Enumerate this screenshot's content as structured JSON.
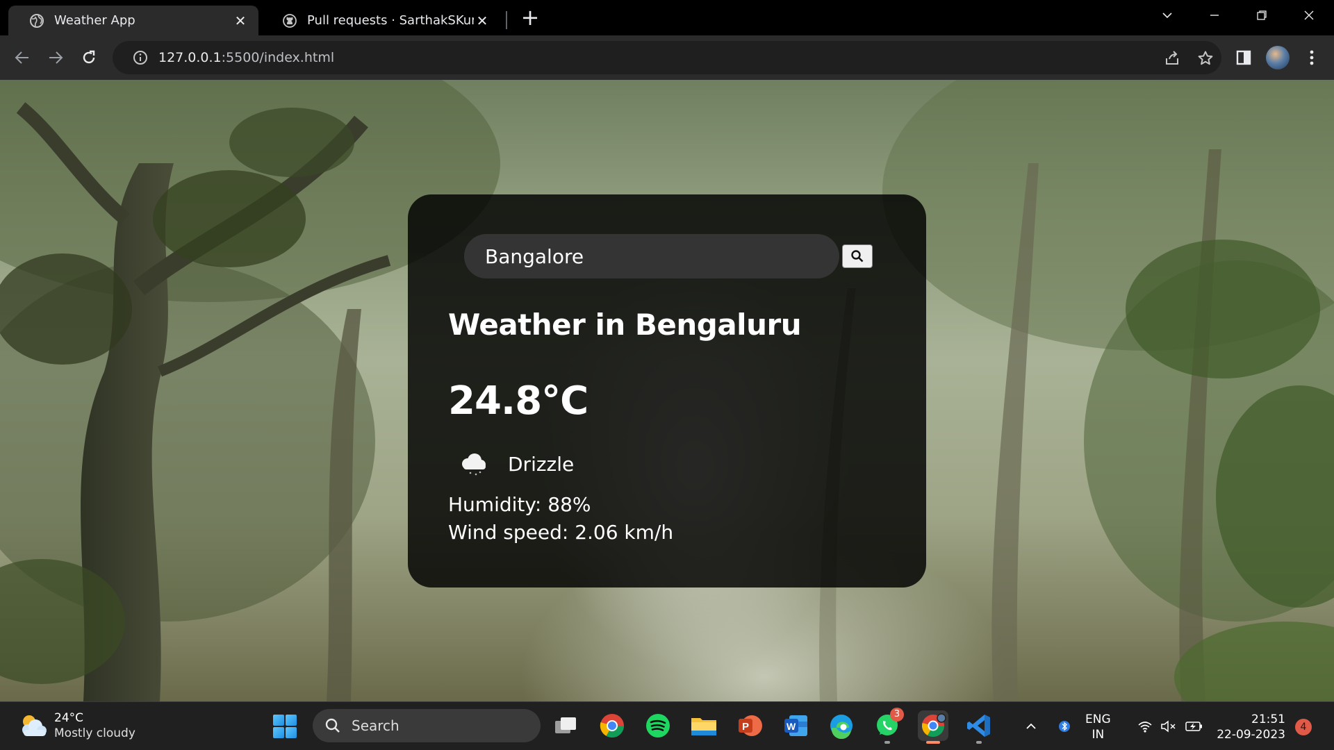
{
  "browser": {
    "tabs": [
      {
        "title": "Weather App",
        "close": "✕"
      },
      {
        "title": "Pull requests · SarthakSKumar/Ne",
        "close": "✕"
      }
    ],
    "new_tab": "+",
    "url_host": "127.0.0.1",
    "url_rest": ":5500/index.html"
  },
  "weather_card": {
    "search_value": "Bangalore",
    "city_heading": "Weather in Bengaluru",
    "temperature": "24.8°C",
    "condition": "Drizzle",
    "humidity": "Humidity: 88%",
    "wind": "Wind speed: 2.06 km/h"
  },
  "taskbar": {
    "weather_temp": "24°C",
    "weather_desc": "Mostly cloudy",
    "search_label": "Search",
    "apps": [
      "file-explorer-copy",
      "chrome",
      "spotify",
      "file-explorer",
      "powerpoint",
      "word",
      "edge",
      "whatsapp",
      "chrome-profile",
      "vscode"
    ],
    "whatsapp_badge": "3",
    "lang_top": "ENG",
    "lang_bottom": "IN",
    "time": "21:51",
    "date": "22-09-2023",
    "notifications": "4"
  }
}
